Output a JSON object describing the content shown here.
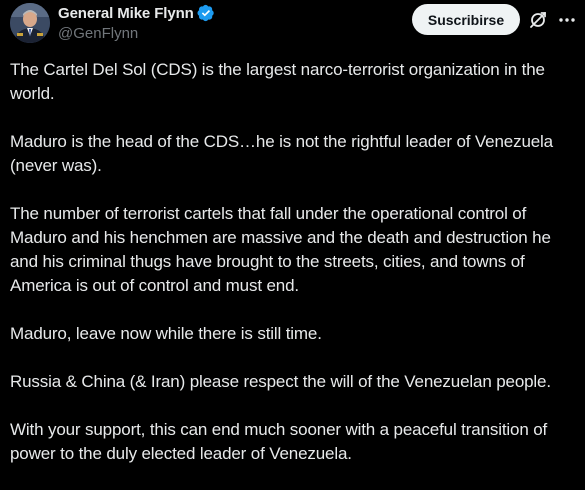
{
  "author": {
    "display_name": "General Mike Flynn",
    "handle": "@GenFlynn",
    "verified": true,
    "avatar_icon": "profile-photo"
  },
  "actions": {
    "subscribe_label": "Suscribirse",
    "grok_icon": "grok-icon",
    "more_icon": "more-icon"
  },
  "post": {
    "paragraphs": [
      "The Cartel Del Sol (CDS) is the largest narco-terrorist organization in the world.",
      "Maduro is the head of the CDS…he is not the rightful leader of Venezuela (never was).",
      "The number of terrorist cartels that fall under the operational control of Maduro and his henchmen are massive and the death and destruction he and his criminal thugs have brought to the streets, cities, and towns of America is out of control and must end.",
      "Maduro, leave now while there is still time.",
      "Russia & China (& Iran) please respect the will of the Venezuelan people.",
      "With your support, this can end much sooner with a peaceful transition of power to the duly elected leader of Venezuela."
    ]
  },
  "colors": {
    "background": "#000000",
    "text_primary": "#e7e9ea",
    "text_secondary": "#71767b",
    "verified_badge": "#1d9bf0",
    "button_bg": "#eff3f4"
  }
}
